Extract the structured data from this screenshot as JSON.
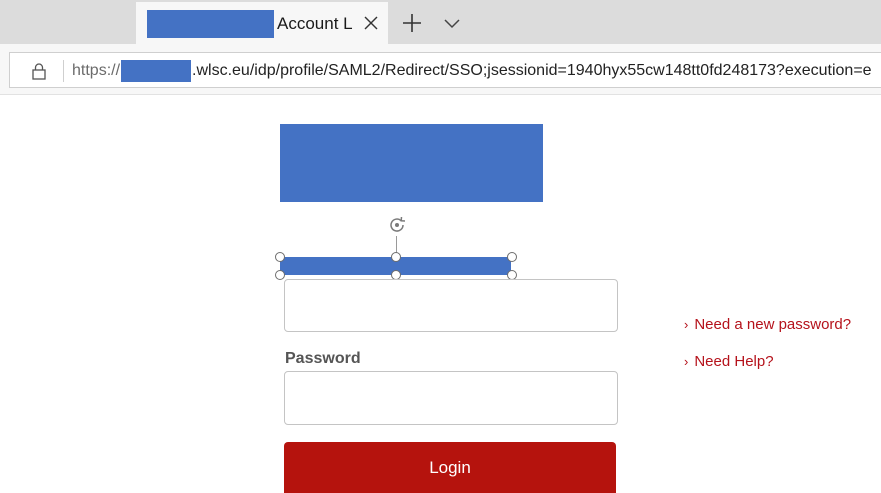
{
  "browser": {
    "tab": {
      "title": "Account L",
      "close_icon": "close-icon"
    },
    "new_tab_icon": "plus-icon",
    "tab_overflow_icon": "chevron-down-icon",
    "address": {
      "lock_icon": "lock-icon",
      "scheme": "https://",
      "url_rest": ".wlsc.eu/idp/profile/SAML2/Redirect/SSO;jsessionid=1940hyx55cw148tt0fd248173?execution=e"
    }
  },
  "login_form": {
    "username_value": "",
    "password_label": "Password",
    "password_value": "",
    "login_label": "Login"
  },
  "side_links": {
    "new_password": "Need a new password?",
    "help": "Need Help?"
  },
  "colors": {
    "redaction": "#4472c4",
    "login_button": "#b5130d",
    "link": "#b5121b",
    "tab_strip": "#dcdcdc"
  }
}
